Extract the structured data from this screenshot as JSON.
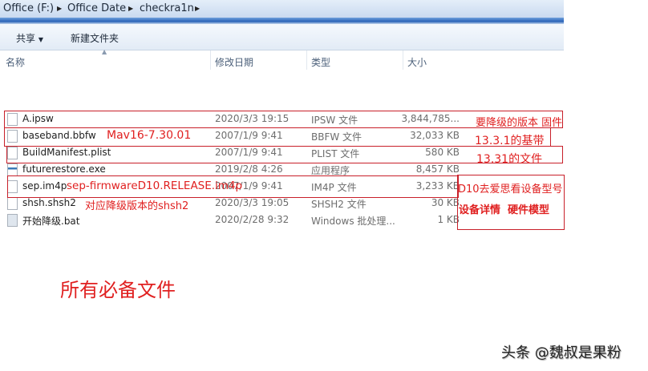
{
  "breadcrumb": [
    "Office (F:)",
    "Office Date",
    "checkra1n"
  ],
  "toolbar": {
    "share": "共享",
    "new_folder": "新建文件夹"
  },
  "columns": {
    "name": "名称",
    "date": "修改日期",
    "type": "类型",
    "size": "大小"
  },
  "files": [
    {
      "name": "A.ipsw",
      "date": "2020/3/3 19:15",
      "type": "IPSW 文件",
      "size": "3,844,785...",
      "icon": "file-icon"
    },
    {
      "name": "baseband.bbfw",
      "date": "2007/1/9 9:41",
      "type": "BBFW 文件",
      "size": "32,033 KB",
      "icon": "file-icon"
    },
    {
      "name": "BuildManifest.plist",
      "date": "2007/1/9 9:41",
      "type": "PLIST 文件",
      "size": "580 KB",
      "icon": "file-icon"
    },
    {
      "name": "futurerestore.exe",
      "date": "2019/2/8 4:26",
      "type": "应用程序",
      "size": "8,457 KB",
      "icon": "exe-icon"
    },
    {
      "name": "sep.im4p",
      "date": "2007/1/9 9:41",
      "type": "IM4P 文件",
      "size": "3,233 KB",
      "icon": "file-icon"
    },
    {
      "name": "shsh.shsh2",
      "date": "2020/3/3 19:05",
      "type": "SHSH2 文件",
      "size": "30 KB",
      "icon": "file-icon"
    },
    {
      "name": "开始降级.bat",
      "date": "2020/2/28 9:32",
      "type": "Windows 批处理...",
      "size": "1 KB",
      "icon": "bat-icon"
    }
  ],
  "annotations": {
    "firmware": "要降级的版本 固件",
    "baseband_version": "Mav16-7.30.01",
    "baseband_note": "13.3.1的基带",
    "plist_note": "13.31的文件",
    "sep_name": "sep-firmwareD10.RELEASE.im4p",
    "device_note": "D10去爱思看设备型号",
    "device_path": "设备详情  硬件模型",
    "shsh_note": "对应降级版本的shsh2",
    "title": "所有必备文件"
  },
  "watermark": "头条 @魏叔是果粉"
}
